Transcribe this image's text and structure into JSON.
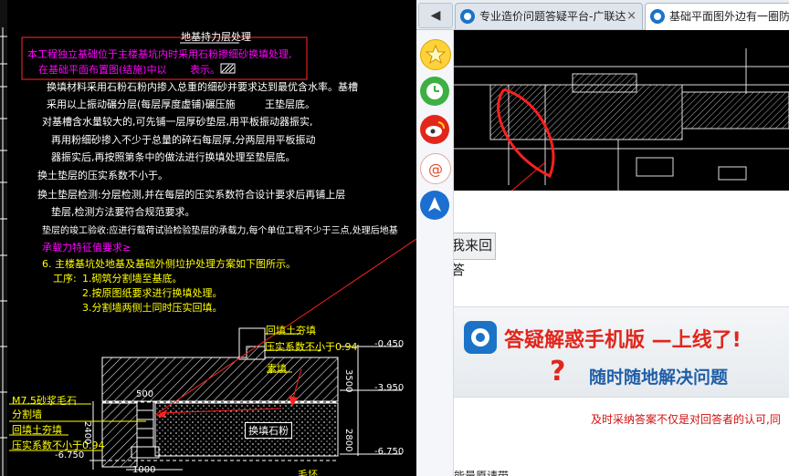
{
  "cad": {
    "title": "地基持力层处理",
    "highlight_line1": "本工程独立基础位于主楼基坑内时采用石粉掺细砂换填处理,",
    "highlight_line2": "在基础平面布置图(结施)中以",
    "highlight_line2_b": "表示。",
    "notes": [
      "换填材料采用石粉石粉内掺入总重的细砂并要求达到最优含水率。基槽",
      "采用以上振动碾分层(每层厚度虚铺)碾压施",
      "王垫层底。",
      "对基槽含水量较大的,可先铺一层厚砂垫层,用平板振动器振实,",
      "再用粉细砂掺入不少于总量的碎石每层厚,分两层用平板振动",
      "器振实后,再按照第条中的做法进行换填处理至垫层底。",
      "换土垫层的压实系数不小于。",
      "换土垫层检测:分层检测,并在每层的压实系数符合设计要求后再铺上层",
      "垫层,检测方法要符合规范要求。",
      "垫层的竣工验收:应进行载荷试验检验垫层的承载力,每个单位工程不少于三点,处理后地基"
    ],
    "magenta_note": "承载力特征值要求≥",
    "item6": "6.  主楼基坑处地基及基础外侧垃护处理方案如下图所示。",
    "proc_label": "工序:",
    "proc_steps": [
      "1.砌筑分割墙至基底。",
      "2.按原图纸要求进行换填处理。",
      "3.分割墙两侧土同时压实回填。"
    ],
    "label_backfill": "回填土夯填",
    "label_compact": "压实系数不小于0.94",
    "label_grade": "素填",
    "label_mortar": "M7.5砂浆毛石",
    "label_wall": "分割墙",
    "label_backfill2": "回填土夯填",
    "label_compact2": "压实系数不小于0.94",
    "label_fill": "换填石粉",
    "label_bottom": "毛坯",
    "levels": [
      "-0.450",
      "-3.950",
      "-6.750",
      "-6.750"
    ],
    "dims": [
      "3500",
      "2800",
      "500",
      "2400",
      "1000"
    ]
  },
  "browser": {
    "back_icon": "back-arrow-icon",
    "tabs": [
      {
        "label": "专业造价问题答疑平台-广联达",
        "icon": "glodon-icon"
      },
      {
        "label": "基础平面图外边有一圈防",
        "icon": "glodon-icon"
      }
    ],
    "sidebar_icons": [
      "star-icon",
      "clock-icon",
      "weibo-icon",
      "email-icon",
      "app-icon"
    ],
    "answer_button": "我来回答",
    "banner_title": "答疑解惑手机版 —上线了!",
    "banner_sub": "随时随地解决问题",
    "notice": "及时采纳答案不仅是对回答者的认可,同",
    "bottom_text": "能量原请带"
  }
}
